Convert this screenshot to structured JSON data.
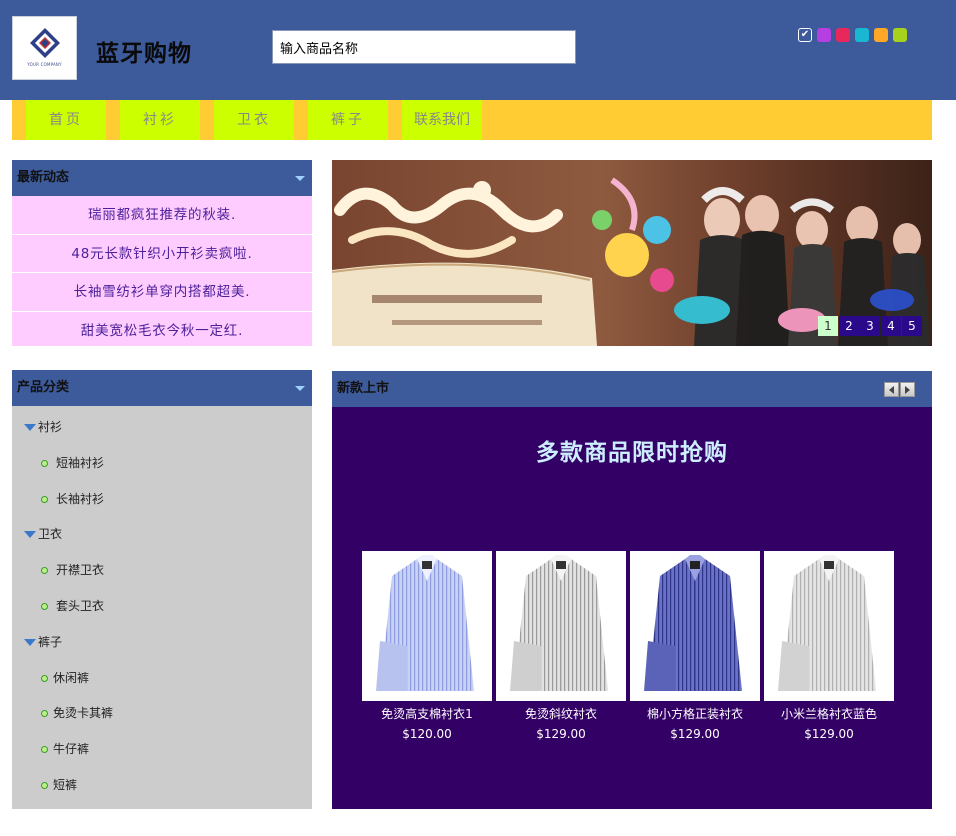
{
  "header": {
    "logo_caption": "YOUR COMPANY",
    "site_title": "蓝牙购物",
    "search_placeholder": "输入商品名称",
    "theme_swatches": [
      {
        "color": "#3d5a9b",
        "checked": true
      },
      {
        "color": "#b53fe0",
        "checked": false
      },
      {
        "color": "#e8285a",
        "checked": false
      },
      {
        "color": "#1ab7d3",
        "checked": false
      },
      {
        "color": "#ffa726",
        "checked": false
      },
      {
        "color": "#a6d21e",
        "checked": false
      }
    ]
  },
  "nav": {
    "items": [
      "首页",
      "衬衫",
      "卫衣",
      "裤子",
      "联系我们"
    ]
  },
  "news": {
    "title": "最新动态",
    "items": [
      "瑞丽都疯狂推荐的秋装.",
      "48元长款针织小开衫卖疯啦.",
      "长袖雪纺衫单穿内搭都超美.",
      "甜美宽松毛衣今秋一定红."
    ]
  },
  "banner": {
    "pager": [
      "1",
      "2",
      "3",
      "4",
      "5"
    ],
    "active_page": 1
  },
  "categories": {
    "title": "产品分类",
    "groups": [
      {
        "label": "衬衫",
        "items": [
          "短袖衬衫",
          "长袖衬衫"
        ]
      },
      {
        "label": "卫衣",
        "items": [
          "开襟卫衣",
          "套头卫衣"
        ]
      },
      {
        "label": "裤子",
        "items": [
          "休闲裤",
          "免烫卡其裤",
          "牛仔裤",
          "短裤"
        ]
      }
    ]
  },
  "new_arrivals": {
    "title": "新款上市",
    "promo_title": "多款商品限时抢购",
    "products": [
      {
        "name": "免烫高支棉衬衣1",
        "price": "$120.00"
      },
      {
        "name": "免烫斜纹衬衣",
        "price": "$129.00"
      },
      {
        "name": "棉小方格正装衬衣",
        "price": "$129.00"
      },
      {
        "name": "小米兰格衬衣蓝色",
        "price": "$129.00"
      }
    ]
  },
  "colors": {
    "header_bg": "#3d5a9b",
    "nav_bg": "#ffcc33",
    "nav_item_bg": "#ccff00",
    "news_bg": "#ffccff",
    "category_bg": "#cccccc",
    "new_body_bg": "#330066"
  }
}
